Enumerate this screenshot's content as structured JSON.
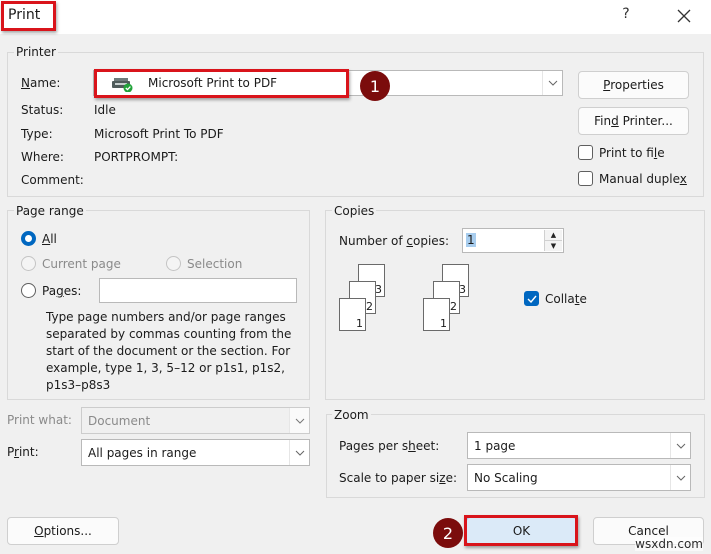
{
  "window": {
    "title": "Print",
    "help_label": "?",
    "close_label": "✕"
  },
  "printer": {
    "group_label": "Printer",
    "name_label": "Name:",
    "name_value": "Microsoft Print to PDF",
    "status_label": "Status:",
    "status_value": "Idle",
    "type_label": "Type:",
    "type_value": "Microsoft Print To PDF",
    "where_label": "Where:",
    "where_value": "PORTPROMPT:",
    "comment_label": "Comment:",
    "comment_value": "",
    "properties_label": "Properties",
    "find_printer_label": "Find Printer...",
    "print_to_file_label": "Print to file",
    "print_to_file_checked": false,
    "manual_duplex_label": "Manual duplex",
    "manual_duplex_checked": false
  },
  "page_range": {
    "group_label": "Page range",
    "all_label": "All",
    "current_page_label": "Current page",
    "selection_label": "Selection",
    "pages_label": "Pages:",
    "pages_value": "",
    "selected": "All",
    "help_text": "Type page numbers and/or page ranges separated by commas counting from the start of the document or the section. For example, type 1, 3, 5–12 or p1s1, p1s2, p1s3–p8s3"
  },
  "copies": {
    "group_label": "Copies",
    "number_label": "Number of copies:",
    "number_value": "1",
    "collate_label": "Collate",
    "collate_checked": true,
    "page_icons": [
      "1",
      "2",
      "3"
    ]
  },
  "print_what": {
    "label": "Print what:",
    "value": "Document"
  },
  "print": {
    "label": "Print:",
    "value": "All pages in range"
  },
  "zoom": {
    "group_label": "Zoom",
    "pages_per_sheet_label": "Pages per sheet:",
    "pages_per_sheet_value": "1 page",
    "scale_label": "Scale to paper size:",
    "scale_value": "No Scaling"
  },
  "footer": {
    "options_label": "Options...",
    "ok_label": "OK",
    "cancel_label": "Cancel"
  },
  "annotations": {
    "step1": "1",
    "step2": "2",
    "highlight_color": "#d9141b",
    "badge_color": "#7b0c0c"
  },
  "watermark": "wsxdn.com"
}
